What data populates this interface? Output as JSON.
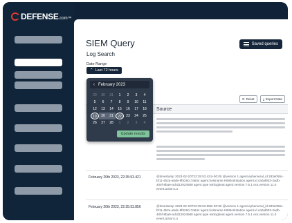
{
  "brand": {
    "logo_text": "DEFENSE",
    "logo_suffix": ".com™"
  },
  "page": {
    "title": "SIEM Query",
    "subtitle": "Log Search"
  },
  "toolbar": {
    "saved_queries_label": "Saved queries",
    "reset_label": "Reset",
    "export_label": "Export Data"
  },
  "filter": {
    "date_range_label": "Date Range",
    "date_range_value": "Last 72 hours"
  },
  "calendar": {
    "month_label": "February 2023",
    "update_label": "Update results",
    "weeks": [
      [
        "29",
        "30",
        "31",
        "1",
        "2",
        "3",
        "4"
      ],
      [
        "5",
        "6",
        "7",
        "8",
        "9",
        "10",
        "11"
      ],
      [
        "12",
        "13",
        "14",
        "15",
        "16",
        "17",
        "18"
      ],
      [
        "19",
        "20",
        "21",
        "22",
        "23",
        "24",
        "25"
      ],
      [
        "26",
        "27",
        "28",
        "1",
        "2",
        "3",
        "4"
      ]
    ]
  },
  "table": {
    "source_header": "Source",
    "rows": [
      {
        "date": "February 20th 2023, 22:35:53.421",
        "source": "@timestamp 2023-02-20T22:35:53.421+00:00 @version 1 agent.ephemeral_id 283e055c-bf11-4b2a-a5de-9f526cc7a844 agent.hostname HBMorkstation agent.id ca0af603-2adb-405f-8ba9-acbd12924588 agent.type winlogbeat agent.version 7.5.1 ecs.version 11.0 event.action Lo"
      },
      {
        "date": "February 20th 2023, 22:35:53.856",
        "source": "@timestamp 2023-02-20T22:35:53.856+00:00 @version 1 agent.ephemeral_id 283e055c-bf11-4b2a-a5de-9f526cc7a844 agent.hostname HBMorkstation agent.id ca0af603-2adb-405f-8ba9-acbd12924588 agent.type winlogbeat agent.version 7.5.1 ecs.version 11.0 event.action Lo"
      }
    ]
  }
}
